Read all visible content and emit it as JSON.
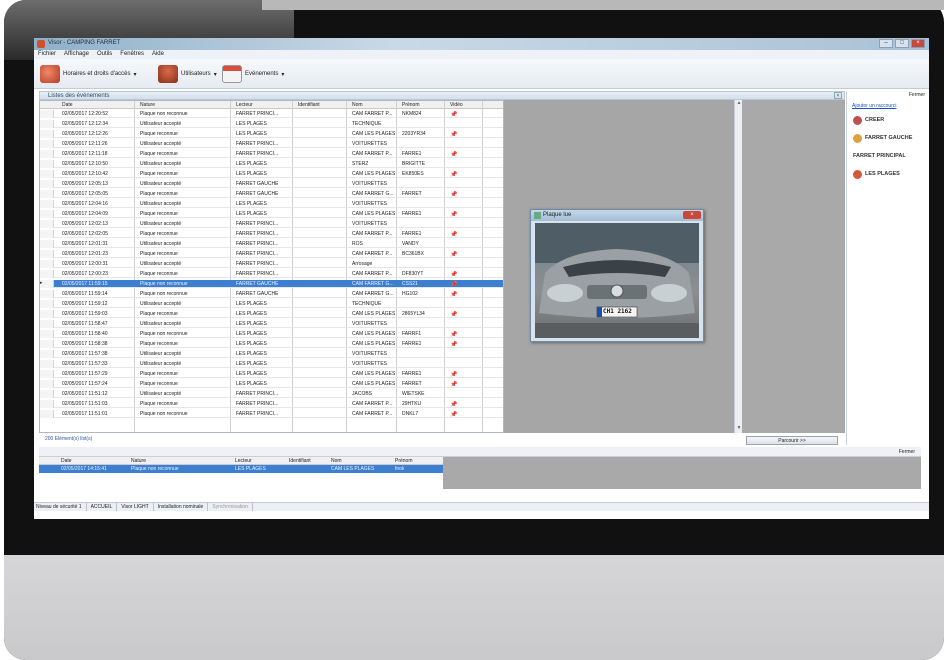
{
  "window": {
    "title": "Visor - CAMPING FARRET"
  },
  "menu": [
    "Fichier",
    "Affichage",
    "Outils",
    "Fenêtres",
    "Aide"
  ],
  "toolbar": {
    "item1": "Horaires et droits d'accès",
    "item2": "Utilisateurs",
    "item3": "Evénements",
    "caret": "▾"
  },
  "panel": {
    "title": "Listes des événements",
    "close": "×"
  },
  "grid": {
    "columns": [
      "Date",
      "Nature",
      "Lecteur",
      "Identifiant",
      "Nom",
      "Prénom",
      "Vidéo"
    ],
    "rows": [
      [
        "02/05/2017 12:20:52",
        "Plaque non reconnue",
        "FARRET PRINCI...",
        "",
        "CAM FARRET P...",
        "NKM824",
        "📌"
      ],
      [
        "02/05/2017 12:12:34",
        "Utilisateur accepté",
        "LES PLAGES",
        "",
        "TECHNIQUE",
        "",
        ""
      ],
      [
        "02/05/2017 12:12:26",
        "Plaque reconnue",
        "LES PLAGES",
        "",
        "CAM LES PLAGES",
        "2203YR34",
        "📌"
      ],
      [
        "02/05/2017 12:11:26",
        "Utilisateur accepté",
        "FARRET PRINCI...",
        "",
        "VOITURETTES",
        "",
        ""
      ],
      [
        "02/05/2017 12:11:18",
        "Plaque reconnue",
        "FARRET PRINCI...",
        "",
        "CAM FARRET P...",
        "FARRE1",
        "📌"
      ],
      [
        "02/05/2017 12:10:50",
        "Utilisateur accepté",
        "LES PLAGES",
        "",
        "STERZ",
        "BRIGITTE",
        ""
      ],
      [
        "02/05/2017 12:10:42",
        "Plaque reconnue",
        "LES PLAGES",
        "",
        "CAM LES PLAGES",
        "EK850ES",
        "📌"
      ],
      [
        "02/05/2017 12:05:13",
        "Utilisateur accepté",
        "FARRET GAUCHE",
        "",
        "VOITURETTES",
        "",
        ""
      ],
      [
        "02/05/2017 12:05:05",
        "Plaque reconnue",
        "FARRET GAUCHE",
        "",
        "CAM FARRET G...",
        "FARRET",
        "📌"
      ],
      [
        "02/05/2017 12:04:16",
        "Utilisateur accepté",
        "LES PLAGES",
        "",
        "VOITURETTES",
        "",
        ""
      ],
      [
        "02/05/2017 12:04:09",
        "Plaque reconnue",
        "LES PLAGES",
        "",
        "CAM LES PLAGES",
        "FARRE1",
        "📌"
      ],
      [
        "02/05/2017 12:02:13",
        "Utilisateur accepté",
        "FARRET PRINCI...",
        "",
        "VOITURETTES",
        "",
        ""
      ],
      [
        "02/05/2017 12:02:05",
        "Plaque reconnue",
        "FARRET PRINCI...",
        "",
        "CAM FARRET P...",
        "FARRE1",
        "📌"
      ],
      [
        "02/05/2017 12:01:31",
        "Utilisateur accepté",
        "FARRET PRINCI...",
        "",
        "ROS",
        "VANDY",
        ""
      ],
      [
        "02/05/2017 12:01:23",
        "Plaque reconnue",
        "FARRET PRINCI...",
        "",
        "CAM FARRET P...",
        "BC361BX",
        "📌"
      ],
      [
        "02/05/2017 12:00:31",
        "Utilisateur accepté",
        "FARRET PRINCI...",
        "",
        "Arrosage",
        "",
        ""
      ],
      [
        "02/05/2017 12:00:23",
        "Plaque reconnue",
        "FARRET PRINCI...",
        "",
        "CAM FARRET P...",
        "DF830YT",
        "📌"
      ],
      [
        "02/05/2017 11:59:15",
        "Plaque non reconnue",
        "FARRET GAUCHE",
        "",
        "CAM FARRET G...",
        "CSS21",
        "📌"
      ],
      [
        "02/05/2017 11:59:14",
        "Plaque non reconnue",
        "FARRET GAUCHE",
        "",
        "CAM FARRET G...",
        "HG102",
        "📌"
      ],
      [
        "02/05/2017 11:59:12",
        "Utilisateur accepté",
        "LES PLAGES",
        "",
        "TECHNIQUE",
        "",
        ""
      ],
      [
        "02/05/2017 11:59:03",
        "Plaque reconnue",
        "LES PLAGES",
        "",
        "CAM LES PLAGES",
        "2865YL34",
        "📌"
      ],
      [
        "02/05/2017 11:58:47",
        "Utilisateur accepté",
        "LES PLAGES",
        "",
        "VOITURETTES",
        "",
        ""
      ],
      [
        "02/05/2017 11:58:40",
        "Plaque non reconnue",
        "LES PLAGES",
        "",
        "CAM LES PLAGES",
        "FARRF1",
        "📌"
      ],
      [
        "02/05/2017 11:58:38",
        "Plaque reconnue",
        "LES PLAGES",
        "",
        "CAM LES PLAGES",
        "FARRE1",
        "📌"
      ],
      [
        "02/05/2017 11:57:38",
        "Utilisateur accepté",
        "LES PLAGES",
        "",
        "VOITURETTES",
        "",
        ""
      ],
      [
        "02/05/2017 11:57:33",
        "Utilisateur accepté",
        "LES PLAGES",
        "",
        "VOITURETTES",
        "",
        ""
      ],
      [
        "02/05/2017 11:57:29",
        "Plaque reconnue",
        "LES PLAGES",
        "",
        "CAM LES PLAGES",
        "FARRE1",
        "📌"
      ],
      [
        "02/05/2017 11:57:24",
        "Plaque reconnue",
        "LES PLAGES",
        "",
        "CAM LES PLAGES",
        "FARRET",
        "📌"
      ],
      [
        "02/05/2017 11:51:12",
        "Utilisateur accepté",
        "FARRET PRINCI...",
        "",
        "JACOBS",
        "WIETSKE",
        ""
      ],
      [
        "02/05/2017 11:51:03",
        "Plaque reconnue",
        "FARRET PRINCI...",
        "",
        "CAM FARRET P...",
        "29HTKU",
        "📌"
      ],
      [
        "02/05/2017 11:51:01",
        "Plaque non reconnue",
        "FARRET PRINCI...",
        "",
        "CAM FARRET P...",
        "DNKL7",
        "📌"
      ]
    ],
    "selected_row": 17,
    "count_label": "200 Elément(s) list(s)",
    "browse_button": "Parcourir >>"
  },
  "plate_window": {
    "title": "Plaque lue",
    "plate_text": "CH1 2162"
  },
  "bottom": {
    "close": "Fermer",
    "columns": [
      "Date",
      "Nature",
      "Lecteur",
      "Identifiant",
      "Nom",
      "Prénom"
    ],
    "row": [
      "02/05/2017 14:15:41",
      "Plaque non reconnue",
      "LES PLAGES",
      "",
      "CAM LES PLAGES",
      "fnok"
    ]
  },
  "status": [
    "Niveau de sécurité 1",
    "ACCUEIL",
    "Visor LIGHT",
    "Installation nominale",
    "Synchronisation"
  ],
  "sidebar": {
    "close": "Fermer",
    "link": "Ajouter un raccourci",
    "items": [
      "CREER",
      "FARRET GAUCHE",
      "FARRET PRINCIPAL",
      "LES PLAGES"
    ]
  },
  "colors": {
    "selection": "#3c7fd1",
    "pin": "#d64a3a",
    "gray_pane": "#a6a6a6"
  }
}
